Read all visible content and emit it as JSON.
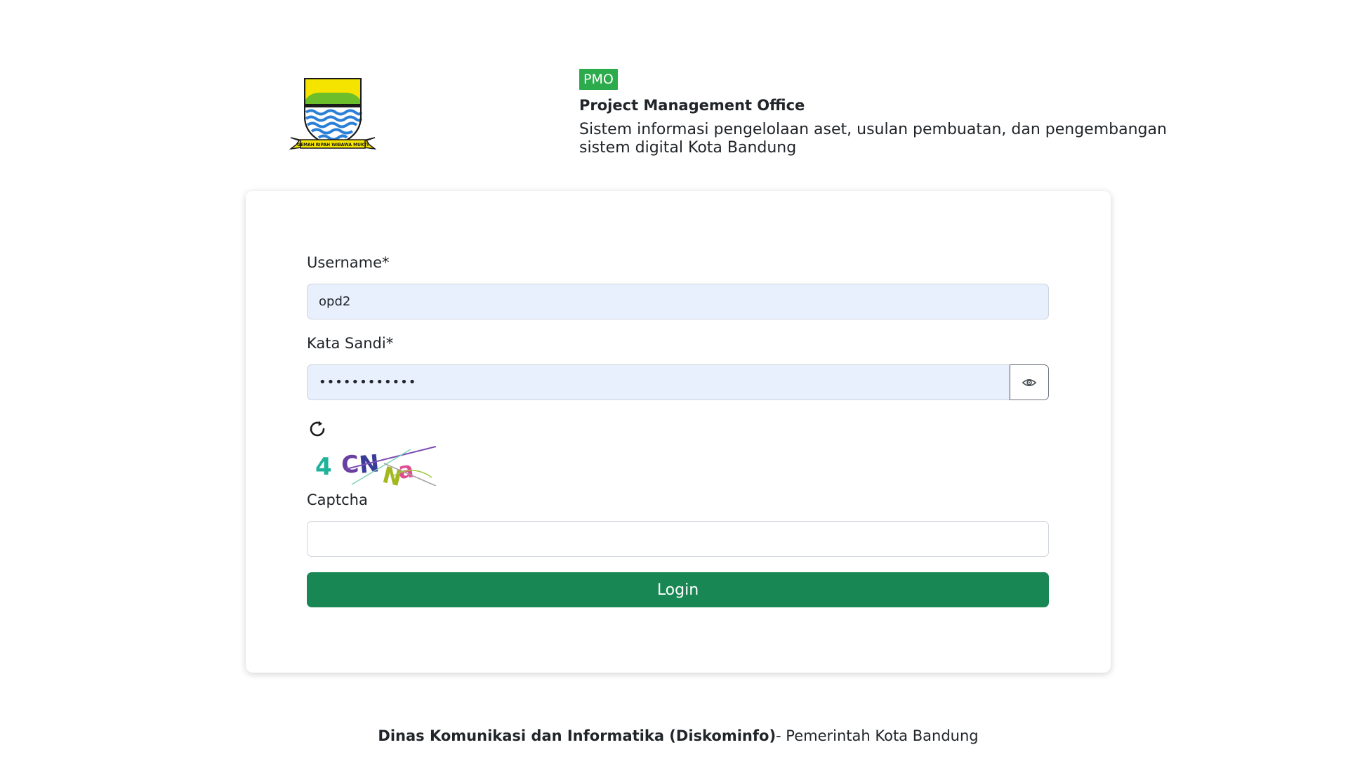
{
  "header": {
    "logo_name": "kota-bandung-emblem",
    "logo_motto": "GEMAH RIPAH WIBAWA MUKTI",
    "badge": "PMO",
    "title": "Project Management Office",
    "description": "Sistem informasi pengelolaan aset, usulan pembuatan, dan pengembangan sistem digital Kota Bandung"
  },
  "form": {
    "username_label": "Username*",
    "username_value": "opd2",
    "password_label": "Kata Sandi*",
    "password_value": "••••••••••••",
    "password_toggle_icon": "eye-icon",
    "refresh_icon": "refresh-icon",
    "captcha_text": "4 CNNa",
    "captcha_label": "Captcha",
    "captcha_value": "",
    "login_label": "Login"
  },
  "footer": {
    "org": "Dinas Komunikasi dan Informatika (Diskominfo)",
    "suffix": "- Pemerintah Kota Bandung"
  },
  "colors": {
    "badge": "#2cab4c",
    "login_button": "#198754",
    "autofill_background": "#e8f0fe"
  }
}
